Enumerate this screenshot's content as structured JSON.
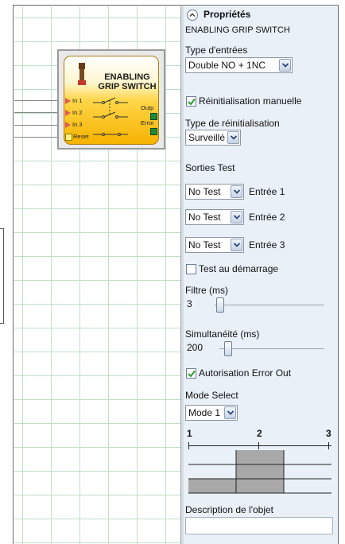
{
  "block": {
    "title_line1": "ENABLING",
    "title_line2": "GRIP SWITCH",
    "inputs": [
      "In 1",
      "In 2",
      "In 3"
    ],
    "reset_label": "Reset",
    "outputs": [
      "Outp",
      "Error"
    ],
    "icon": "grip-switch-icon"
  },
  "panel": {
    "header": "Propriétés",
    "collapse_icon": "chevron-up-icon",
    "object_name": "ENABLING GRIP SWITCH",
    "input_type_label": "Type d'entrées",
    "input_type_value": "Double NO + 1NC",
    "manual_reset_label": "Réinitialisation manuelle",
    "manual_reset_checked": true,
    "reset_type_label": "Type de réinitialisation",
    "reset_type_value": "Surveillé",
    "test_outputs_label": "Sorties Test",
    "test_rows": [
      {
        "value": "No Test",
        "label": "Entrée 1"
      },
      {
        "value": "No Test",
        "label": "Entrée 2"
      },
      {
        "value": "No Test",
        "label": "Entrée 3"
      }
    ],
    "startup_test_label": "Test au démarrage",
    "startup_test_checked": false,
    "filter_label": "Filtre (ms)",
    "filter_value": "3",
    "simultaneity_label": "Simultanéité (ms)",
    "simultaneity_value": "200",
    "error_out_label": "Autorisation Error Out",
    "error_out_checked": true,
    "mode_select_label": "Mode Select",
    "mode_select_value": "Mode 1",
    "mode_positions": [
      "1",
      "2",
      "3"
    ],
    "description_label": "Description de l'objet",
    "description_value": ""
  },
  "colors": {
    "panel_bg": "#eaf0f8",
    "grid": "#bfe0c6",
    "block_yellow": "#f6b200",
    "input_pin": "#e2585a",
    "output_pin": "#1f8a3a",
    "check_green": "#2a9a2a"
  }
}
